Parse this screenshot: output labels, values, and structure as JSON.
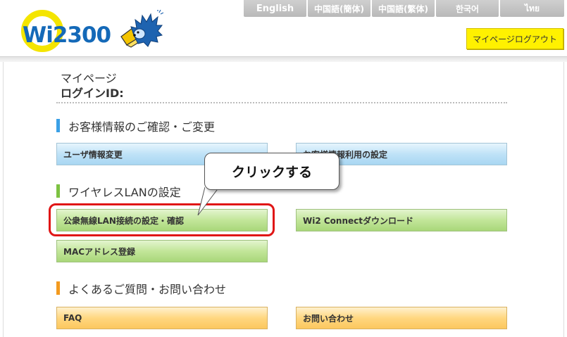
{
  "header": {
    "logo_text": "Wi2300",
    "language_tabs": [
      "English",
      "中国語(簡体)",
      "中国語(繁体)",
      "한국어",
      "ไทย"
    ],
    "logout_label": "マイページログアウト"
  },
  "account": {
    "title": "マイページ",
    "login_id_label": "ログインID:"
  },
  "sections": [
    {
      "title": "お客様情報のご確認・ご変更",
      "color": "#3ba0e6",
      "buttons": [
        "ユーザ情報変更",
        "お客様情報利用の設定"
      ]
    },
    {
      "title": "ワイヤレスLANの設定",
      "color": "#7dc242",
      "buttons": [
        "公衆無線LAN接続の設定・確認",
        "Wi2 Connectダウンロード",
        "MACアドレス登録"
      ]
    },
    {
      "title": "よくあるご質問・お問い合わせ",
      "color": "#f39a1f",
      "buttons": [
        "FAQ",
        "お問い合わせ"
      ]
    }
  ],
  "annotation": {
    "callout_text": "クリックする",
    "highlight_color": "#e01616"
  },
  "colors": {
    "brand_blue": "#1469b8",
    "brand_yellow": "#f4e500",
    "logout_yellow": "#fff100"
  }
}
